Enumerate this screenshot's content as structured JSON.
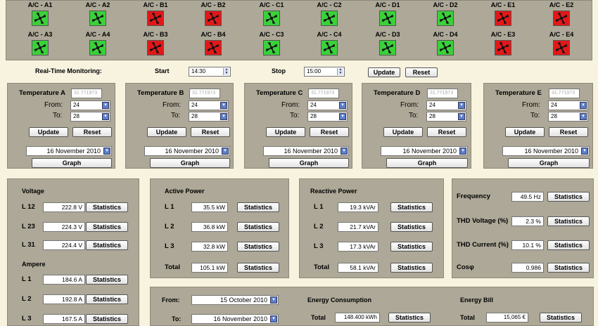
{
  "ac_units": [
    {
      "label": "A/C - A1",
      "state": "on"
    },
    {
      "label": "A/C - A2",
      "state": "on"
    },
    {
      "label": "A/C - B1",
      "state": "off"
    },
    {
      "label": "A/C - B2",
      "state": "off"
    },
    {
      "label": "A/C - C1",
      "state": "on"
    },
    {
      "label": "A/C - C2",
      "state": "on"
    },
    {
      "label": "A/C - D1",
      "state": "on"
    },
    {
      "label": "A/C - D2",
      "state": "on"
    },
    {
      "label": "A/C - E1",
      "state": "off"
    },
    {
      "label": "A/C - E2",
      "state": "off"
    },
    {
      "label": "A/C - A3",
      "state": "on"
    },
    {
      "label": "A/C - A4",
      "state": "on"
    },
    {
      "label": "A/C - B3",
      "state": "off"
    },
    {
      "label": "A/C - B4",
      "state": "off"
    },
    {
      "label": "A/C - C3",
      "state": "on"
    },
    {
      "label": "A/C - C4",
      "state": "on"
    },
    {
      "label": "A/C - D3",
      "state": "on"
    },
    {
      "label": "A/C - D4",
      "state": "on"
    },
    {
      "label": "A/C - E3",
      "state": "off"
    },
    {
      "label": "A/C - E4",
      "state": "off"
    }
  ],
  "colors": {
    "on": "#3ad13a",
    "off": "#e21818",
    "panel": "#ada897",
    "background": "#f7f3df"
  },
  "monitoring": {
    "label": "Real-Time Monitoring:",
    "start_label": "Start",
    "start_value": "14:30",
    "stop_label": "Stop",
    "stop_value": "15:00",
    "update": "Update",
    "reset": "Reset"
  },
  "temperature_panels": [
    {
      "title": "Temperature A",
      "reading": "31.771973",
      "from_label": "From:",
      "from": "24",
      "to_label": "To:",
      "to": "28",
      "update": "Update",
      "reset": "Reset",
      "date": "16 November 2010",
      "graph": "Graph"
    },
    {
      "title": "Temperature B",
      "reading": "31.771973",
      "from_label": "From:",
      "from": "24",
      "to_label": "To:",
      "to": "28",
      "update": "Update",
      "reset": "Reset",
      "date": "16 November 2010",
      "graph": "Graph"
    },
    {
      "title": "Temperature C",
      "reading": "31.771973",
      "from_label": "From:",
      "from": "24",
      "to_label": "To:",
      "to": "28",
      "update": "Update",
      "reset": "Reset",
      "date": "16 November 2010",
      "graph": "Graph"
    },
    {
      "title": "Temperature D",
      "reading": "31.771973",
      "from_label": "From:",
      "from": "24",
      "to_label": "To:",
      "to": "28",
      "update": "Update",
      "reset": "Reset",
      "date": "16 November 2010",
      "graph": "Graph"
    },
    {
      "title": "Temperature E",
      "reading": "31.771973",
      "from_label": "From:",
      "from": "24",
      "to_label": "To:",
      "to": "28",
      "update": "Update",
      "reset": "Reset",
      "date": "16 November 2010",
      "graph": "Graph"
    }
  ],
  "voltage": {
    "title": "Voltage",
    "rows": [
      {
        "label": "L 12",
        "value": "222.8 V"
      },
      {
        "label": "L 23",
        "value": "224.3 V"
      },
      {
        "label": "L 31",
        "value": "224.4 V"
      }
    ]
  },
  "ampere": {
    "title": "Ampere",
    "rows": [
      {
        "label": "L 1",
        "value": "184.6 A"
      },
      {
        "label": "L 2",
        "value": "192.8 A"
      },
      {
        "label": "L 3",
        "value": "167.5 A"
      }
    ]
  },
  "active_power": {
    "title": "Active Power",
    "rows": [
      {
        "label": "L 1",
        "value": "35.5 kW"
      },
      {
        "label": "L 2",
        "value": "36.8 kW"
      },
      {
        "label": "L 3",
        "value": "32.8 kW"
      },
      {
        "label": "Total",
        "value": "105.1 kW"
      }
    ]
  },
  "reactive_power": {
    "title": "Reactive Power",
    "rows": [
      {
        "label": "L 1",
        "value": "19.3 kVAr"
      },
      {
        "label": "L 2",
        "value": "21.7 kVAr"
      },
      {
        "label": "L 3",
        "value": "17.3 kVAr"
      },
      {
        "label": "Total",
        "value": "58.1 kVAr"
      }
    ]
  },
  "quality": {
    "rows": [
      {
        "label": "Frequency",
        "value": "49.5 Hz"
      },
      {
        "label": "THD Voltage (%)",
        "value": "2.3 %"
      },
      {
        "label": "THD Current (%)",
        "value": "10.1 %"
      },
      {
        "label": "Cosφ",
        "value": "0.986"
      }
    ]
  },
  "statistics_label": "Statistics",
  "energy": {
    "from_label": "From:",
    "from_date": "15 October 2010",
    "to_label": "To:",
    "to_date": "16 November 2010",
    "consumption_title": "Energy Consumption",
    "total_label": "Total",
    "consumption_value": "148.400 kWh",
    "bill_title": "Energy Bill",
    "bill_value": "15,065 €"
  }
}
